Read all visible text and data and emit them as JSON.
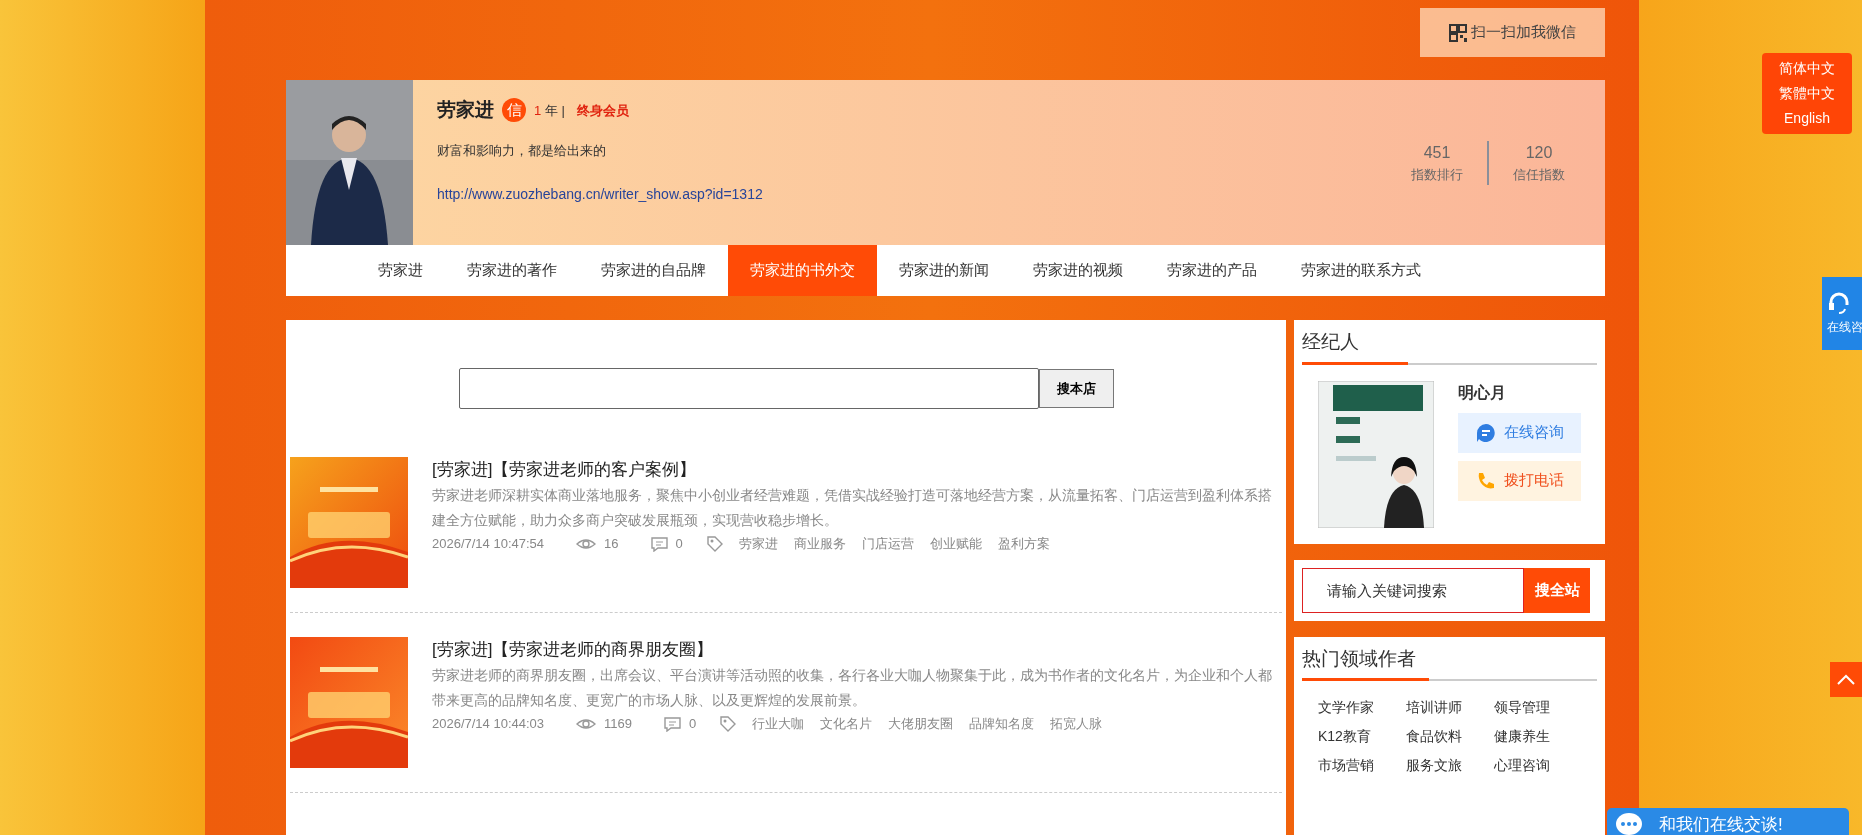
{
  "wechat_button": {
    "label": "扫一扫加我微信"
  },
  "profile": {
    "name": "劳家进",
    "badge": "信",
    "years": "1",
    "years_unit": "年 |",
    "membership": "终身会员",
    "motto": "财富和影响力，都是给出来的",
    "url": "http://www.zuozhebang.cn/writer_show.asp?id=1312",
    "stats": [
      {
        "value": "451",
        "label": "指数排行"
      },
      {
        "value": "120",
        "label": "信任指数"
      }
    ]
  },
  "nav": [
    {
      "label": "劳家进",
      "selected": false
    },
    {
      "label": "劳家进的著作",
      "selected": false
    },
    {
      "label": "劳家进的自品牌",
      "selected": false
    },
    {
      "label": "劳家进的书外交",
      "selected": true
    },
    {
      "label": "劳家进的新闻",
      "selected": false
    },
    {
      "label": "劳家进的视频",
      "selected": false
    },
    {
      "label": "劳家进的产品",
      "selected": false
    },
    {
      "label": "劳家进的联系方式",
      "selected": false
    }
  ],
  "shop_search": {
    "button": "搜本店"
  },
  "articles": [
    {
      "title": "[劳家进]【劳家进老师的客户案例】",
      "summary": "劳家进老师深耕实体商业落地服务，聚焦中小创业者经营难题，凭借实战经验打造可落地经营方案，从流量拓客、门店运营到盈利体系搭建全方位赋能，助力众多商户突破发展瓶颈，实现营收稳步增长。",
      "time": "2026/7/14 10:47:54",
      "views": "16",
      "comments": "0",
      "tags": [
        "劳家进",
        "商业服务",
        "门店运营",
        "创业赋能",
        "盈利方案"
      ]
    },
    {
      "title": "[劳家进]【劳家进老师的商界朋友圈】",
      "summary": "劳家进老师的商界朋友圈，出席会议、平台演讲等活动照的收集，各行各业大咖人物聚集于此，成为书作者的文化名片，为企业和个人都带来更高的品牌知名度、更宽广的市场人脉、以及更辉煌的发展前景。",
      "time": "2026/7/14 10:44:03",
      "views": "1169",
      "comments": "0",
      "tags": [
        "行业大咖",
        "文化名片",
        "大佬朋友圈",
        "品牌知名度",
        "拓宽人脉"
      ]
    }
  ],
  "agent": {
    "heading": "经纪人",
    "name": "明心月",
    "buttons": [
      {
        "kind": "chat",
        "label": "在线咨询"
      },
      {
        "kind": "phone",
        "label": "拨打电话"
      }
    ]
  },
  "site_search": {
    "placeholder": "请输入关键词搜索",
    "button": "搜全站"
  },
  "hot_fields": {
    "heading": "热门领域作者",
    "items": [
      "文学作家",
      "培训讲师",
      "领导管理",
      "K12教育",
      "食品饮料",
      "健康养生",
      "市场营销",
      "服务文旅",
      "心理咨询"
    ]
  },
  "languages": [
    "简体中文",
    "繁體中文",
    "English"
  ],
  "consult_tab": {
    "label": "在线咨"
  },
  "chat_bar": {
    "label": "和我们在线交谈!"
  }
}
